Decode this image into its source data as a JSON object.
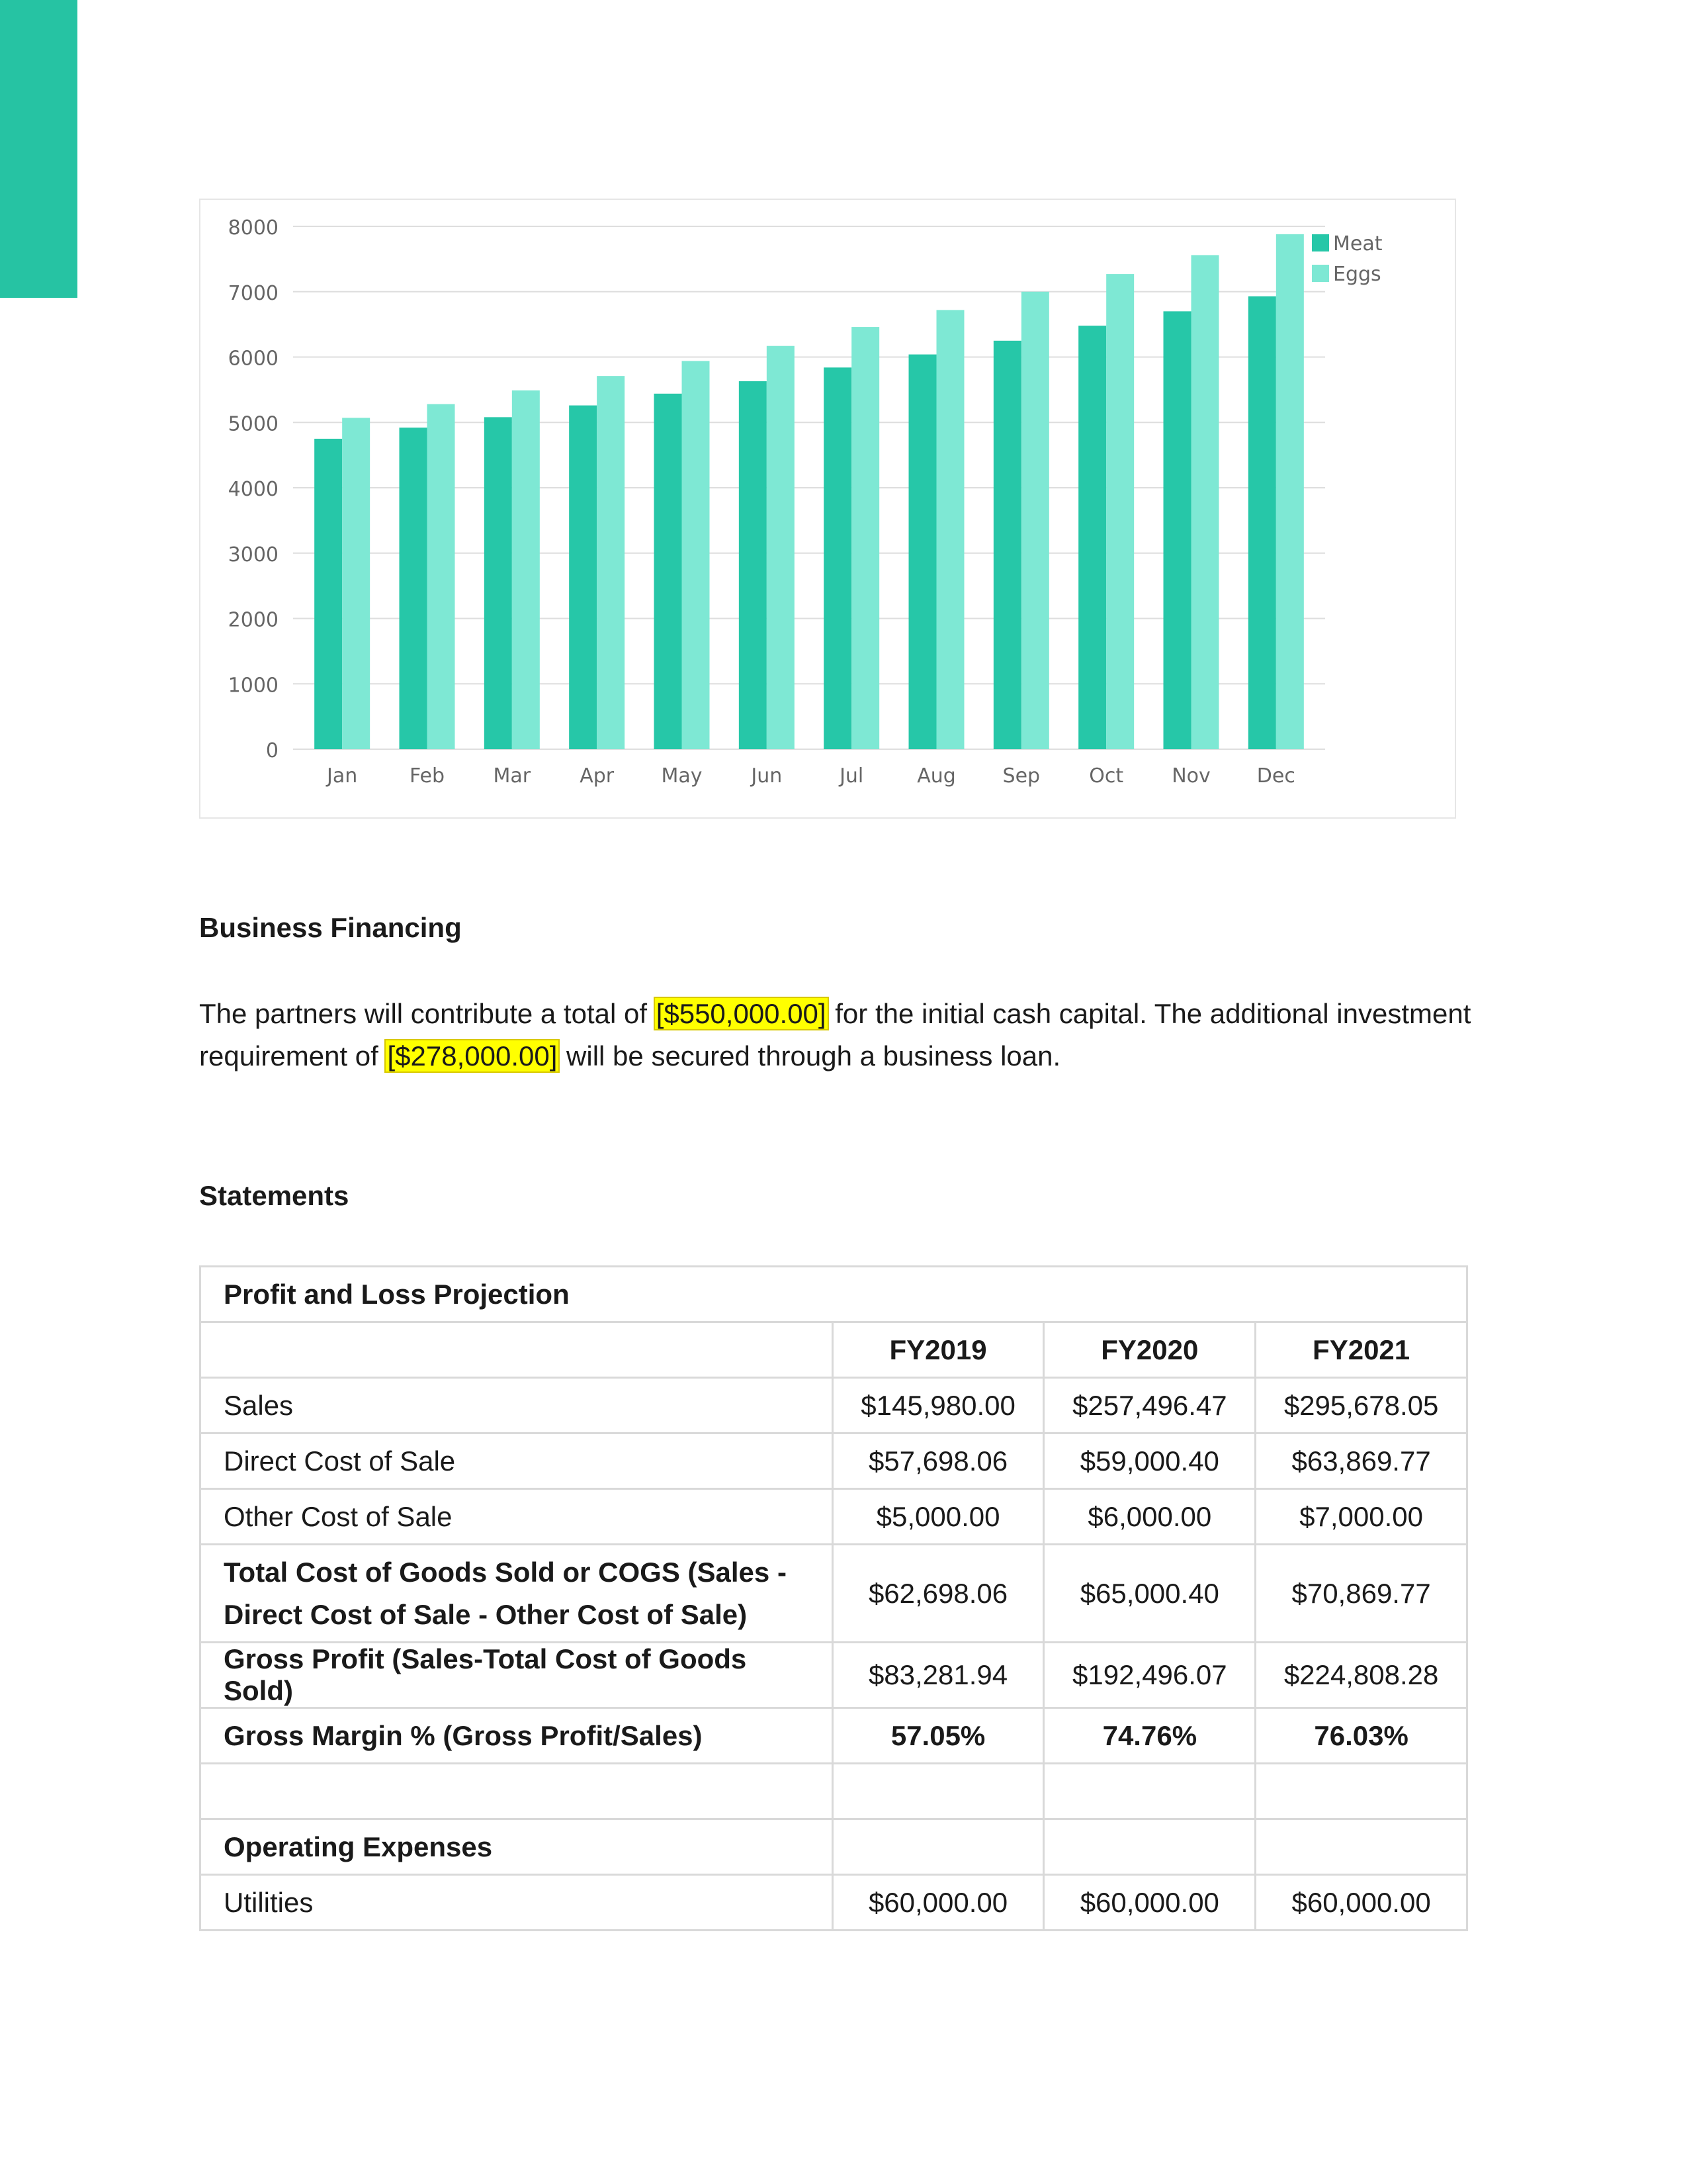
{
  "accent_color": "#26c3a3",
  "chart_data": {
    "type": "bar",
    "categories": [
      "Jan",
      "Feb",
      "Mar",
      "Apr",
      "May",
      "Jun",
      "Jul",
      "Aug",
      "Sep",
      "Oct",
      "Nov",
      "Dec"
    ],
    "series": [
      {
        "name": "Meat",
        "color": "#26c7a8",
        "values": [
          4750,
          4920,
          5080,
          5260,
          5440,
          5630,
          5840,
          6040,
          6250,
          6480,
          6700,
          6930
        ]
      },
      {
        "name": "Eggs",
        "color": "#7ee8d4",
        "values": [
          5070,
          5280,
          5490,
          5710,
          5940,
          6170,
          6460,
          6720,
          7000,
          7270,
          7560,
          7880
        ]
      }
    ],
    "yticks": [
      0,
      1000,
      2000,
      3000,
      4000,
      5000,
      6000,
      7000,
      8000
    ],
    "ylim": [
      0,
      8000
    ],
    "legend": "top-right",
    "grid": true
  },
  "financing": {
    "heading": "Business Financing",
    "text_before": "The partners will contribute a total of ",
    "amount1": "[$550,000.00]",
    "text_middle": " for the initial cash capital. The additional investment requirement of ",
    "amount2": "[$278,000.00]",
    "text_after": " will be secured through a business loan."
  },
  "statements": {
    "heading": "Statements",
    "table_title": "Profit and Loss Projection",
    "columns": [
      "FY2019",
      "FY2020",
      "FY2021"
    ],
    "rows": [
      {
        "label": "Sales",
        "values": [
          "$145,980.00",
          "$257,496.47",
          "$295,678.05"
        ]
      },
      {
        "label": "Direct Cost of Sale",
        "values": [
          "$57,698.06",
          "$59,000.40",
          "$63,869.77"
        ]
      },
      {
        "label": "Other Cost of Sale",
        "values": [
          "$5,000.00",
          "$6,000.00",
          "$7,000.00"
        ]
      },
      {
        "label": "Total Cost of Goods Sold or COGS (Sales - Direct Cost of Sale - Other Cost of Sale)",
        "values": [
          "$62,698.06",
          "$65,000.40",
          "$70,869.77"
        ]
      },
      {
        "label": "Gross Profit (Sales-Total Cost of Goods Sold)",
        "values": [
          "$83,281.94",
          "$192,496.07",
          "$224,808.28"
        ]
      },
      {
        "label": "Gross Margin % (Gross Profit/Sales)",
        "values": [
          "57.05%",
          "74.76%",
          "76.03%"
        ]
      }
    ],
    "operating_heading": "Operating Expenses",
    "operating_rows": [
      {
        "label": "Utilities",
        "values": [
          "$60,000.00",
          "$60,000.00",
          "$60,000.00"
        ]
      }
    ]
  }
}
